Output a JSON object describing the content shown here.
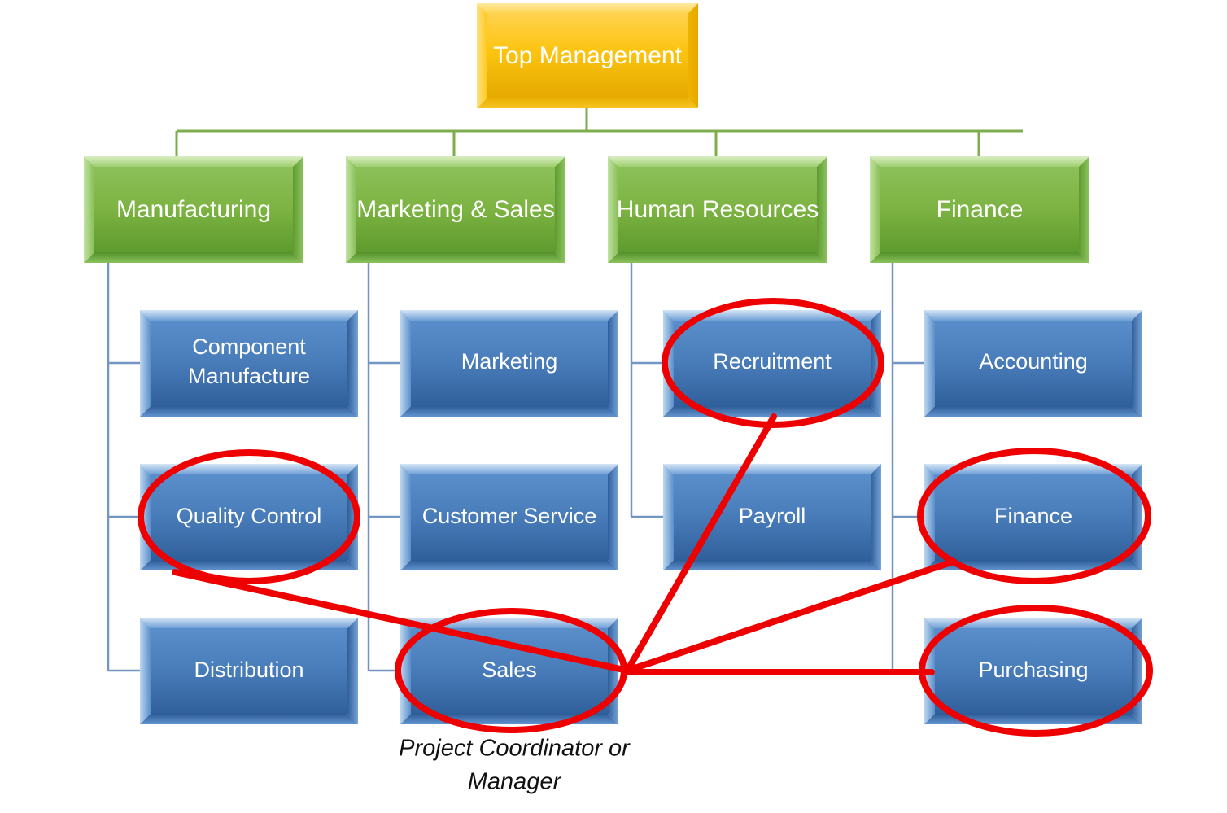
{
  "chart_data": {
    "type": "diagram",
    "title": "Organizational Chart with Project Coordination Highlights",
    "nodes": {
      "top": {
        "label": "Top Management",
        "level": 0,
        "color": "#f0b400"
      },
      "departments": [
        {
          "label": "Manufacturing",
          "color": "#76a940"
        },
        {
          "label": "Marketing & Sales",
          "color": "#76a940"
        },
        {
          "label": "Human Resources",
          "color": "#76a940"
        },
        {
          "label": "Finance",
          "color": "#76a940"
        }
      ],
      "units": [
        {
          "label": "Component Manufacture",
          "parent": "Manufacturing",
          "row": 1,
          "col": 1,
          "highlighted": false
        },
        {
          "label": "Quality Control",
          "parent": "Manufacturing",
          "row": 2,
          "col": 1,
          "highlighted": true
        },
        {
          "label": "Distribution",
          "parent": "Manufacturing",
          "row": 3,
          "col": 1,
          "highlighted": false
        },
        {
          "label": "Marketing",
          "parent": "Marketing & Sales",
          "row": 1,
          "col": 2,
          "highlighted": false
        },
        {
          "label": "Customer Service",
          "parent": "Marketing & Sales",
          "row": 2,
          "col": 2,
          "highlighted": false
        },
        {
          "label": "Sales",
          "parent": "Marketing & Sales",
          "row": 3,
          "col": 2,
          "highlighted": true
        },
        {
          "label": "Recruitment",
          "parent": "Human Resources",
          "row": 1,
          "col": 3,
          "highlighted": true
        },
        {
          "label": "Payroll",
          "parent": "Human Resources",
          "row": 2,
          "col": 3,
          "highlighted": false
        },
        {
          "label": "Accounting",
          "parent": "Finance",
          "row": 1,
          "col": 4,
          "highlighted": false
        },
        {
          "label": "Finance",
          "parent": "Finance",
          "row": 2,
          "col": 4,
          "highlighted": true
        },
        {
          "label": "Purchasing",
          "parent": "Finance",
          "row": 3,
          "col": 4,
          "highlighted": true
        }
      ]
    },
    "caption": "Project Coordinator or Manager",
    "highlight_color": "#ee0000",
    "hierarchy_line_color_top": "#7fad4e",
    "hierarchy_line_color_sub": "#7395c4",
    "project_links": [
      {
        "from": "Sales",
        "to": "Quality Control"
      },
      {
        "from": "Sales",
        "to": "Recruitment"
      },
      {
        "from": "Sales",
        "to": "Finance"
      },
      {
        "from": "Sales",
        "to": "Purchasing"
      }
    ],
    "background": "#ffffff"
  },
  "labels": {
    "top_management": "Top Management",
    "manufacturing": "Manufacturing",
    "marketing_sales": "Marketing & Sales",
    "human_resources": "Human Resources",
    "finance_dept": "Finance",
    "component_manufacture_line1": "Component",
    "component_manufacture_line2": "Manufacture",
    "quality_control": "Quality Control",
    "distribution": "Distribution",
    "marketing": "Marketing",
    "customer_service": "Customer Service",
    "sales": "Sales",
    "recruitment": "Recruitment",
    "payroll": "Payroll",
    "accounting": "Accounting",
    "finance_unit": "Finance",
    "purchasing": "Purchasing",
    "caption_line1": "Project Coordinator or",
    "caption_line2": "Manager"
  }
}
